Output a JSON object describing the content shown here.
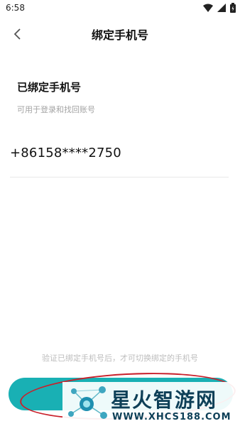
{
  "status_bar": {
    "time": "6:58"
  },
  "header": {
    "title": "绑定手机号"
  },
  "bound": {
    "heading": "已绑定手机号",
    "subtitle": "可用于登录和找回账号",
    "phone": "+86158****2750"
  },
  "footer": {
    "hint": "验证已绑定手机号后，才可切换绑定的手机号"
  },
  "watermark": {
    "title": "星火智游网",
    "url": "WWW.XHCS188.COM"
  },
  "colors": {
    "accent": "#19b0b4",
    "ring": "#c9202b",
    "watermark": "#0d3f57"
  }
}
